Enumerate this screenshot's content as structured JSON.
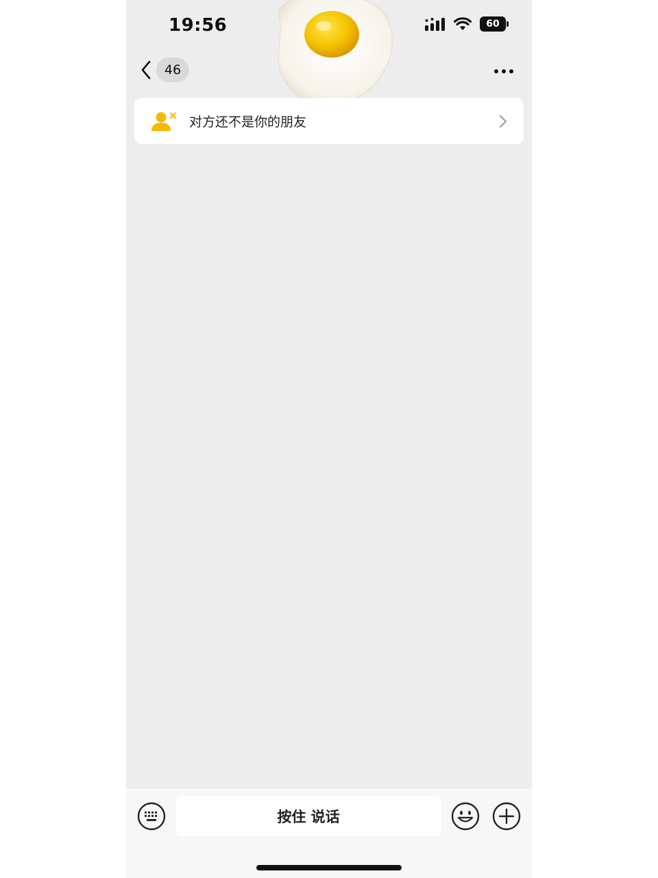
{
  "status_bar": {
    "time": "19:56",
    "battery": "60",
    "icons": [
      "signal-icon",
      "wifi-icon",
      "battery-icon"
    ]
  },
  "nav": {
    "back_badge": "46",
    "icons": [
      "chevron-left-icon",
      "more-icon"
    ]
  },
  "banner": {
    "text": "对方还不是你的朋友",
    "icons": [
      "user-remove-icon",
      "chevron-right-icon"
    ],
    "icon_color": "#f5b800"
  },
  "input_bar": {
    "hold_to_talk": "按住 说话",
    "icons": [
      "keyboard-icon",
      "emoji-icon",
      "plus-icon"
    ]
  },
  "colors": {
    "background": "#ededed",
    "card": "#ffffff",
    "accent_yellow": "#f5b800"
  }
}
